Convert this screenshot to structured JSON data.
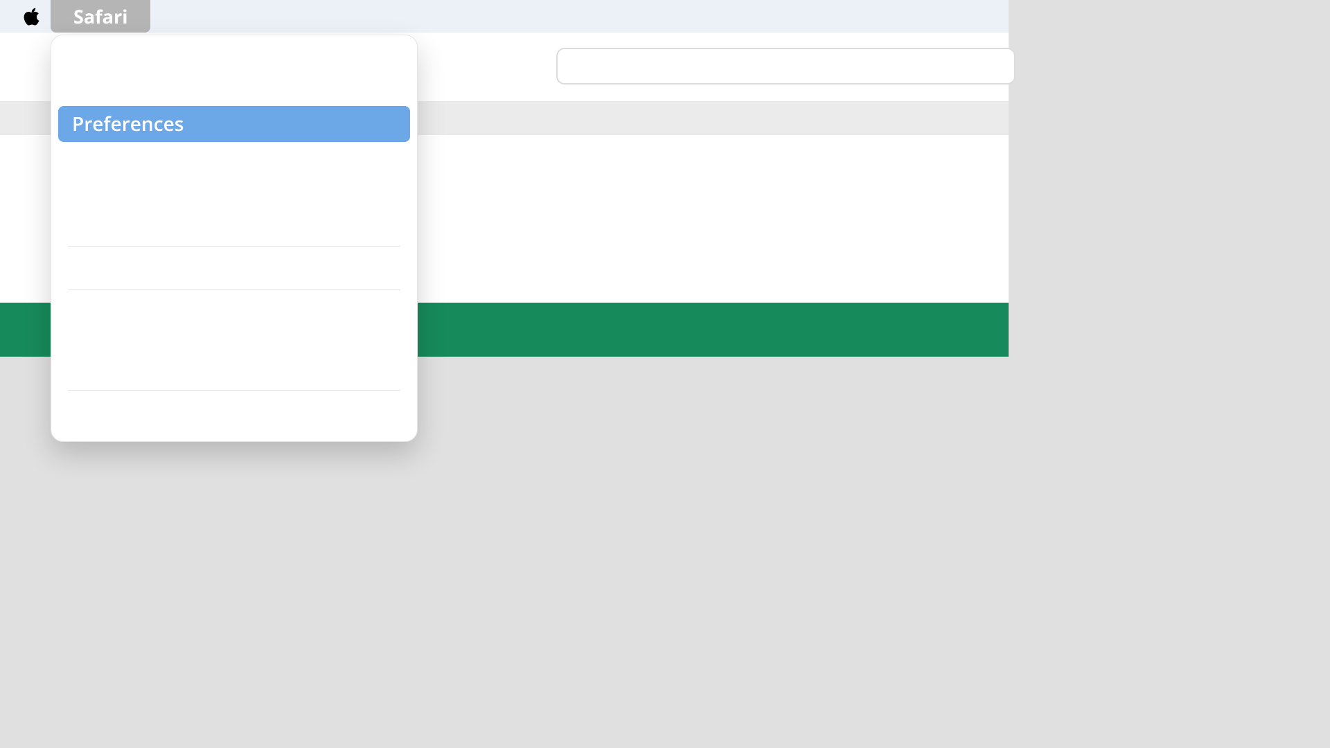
{
  "menubar": {
    "app_label": "Safari"
  },
  "dropdown": {
    "items": [
      {
        "label": "Preferences",
        "highlighted": true
      }
    ]
  },
  "colors": {
    "accent_green": "#178a5b",
    "highlight_blue": "#6ca7e8",
    "menubar_bg": "#ecf0f7",
    "active_menu_bg": "#b5b5b5"
  }
}
